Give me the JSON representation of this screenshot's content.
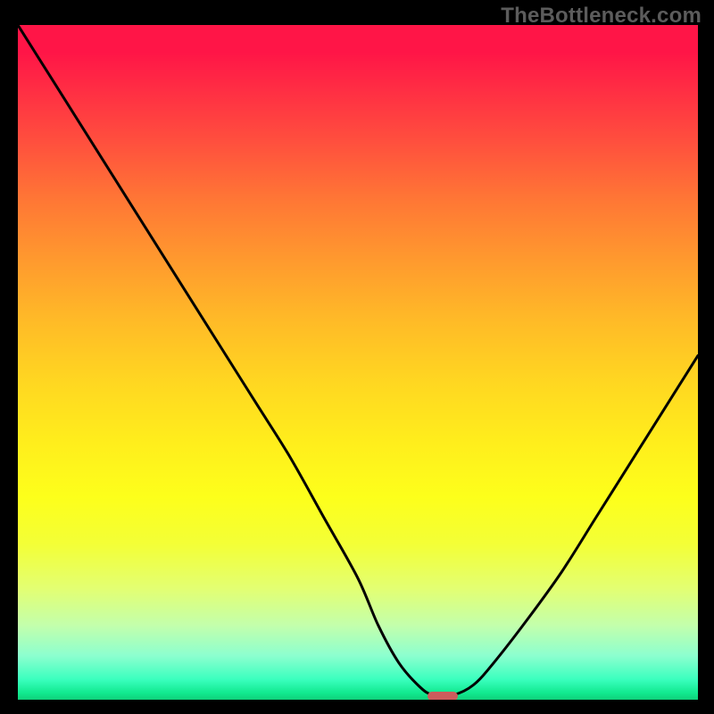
{
  "watermark": "TheBottleneck.com",
  "colors": {
    "frame": "#000000",
    "curve": "#000000",
    "marker": "#cd5c5c"
  },
  "chart_data": {
    "type": "line",
    "title": "",
    "xlabel": "",
    "ylabel": "",
    "xlim": [
      0,
      100
    ],
    "ylim": [
      0,
      100
    ],
    "grid": false,
    "x": [
      0,
      5,
      10,
      15,
      20,
      25,
      30,
      35,
      40,
      45,
      50,
      53,
      56,
      59,
      61,
      64,
      67,
      70,
      75,
      80,
      85,
      90,
      95,
      100
    ],
    "values": [
      100,
      92,
      84,
      76,
      68,
      60,
      52,
      44,
      36,
      27,
      18,
      11,
      5.5,
      2,
      0.7,
      0.7,
      2.2,
      5.5,
      12,
      19,
      27,
      35,
      43,
      51
    ],
    "series": [
      {
        "name": "bottleneck-curve",
        "values": [
          100,
          92,
          84,
          76,
          68,
          60,
          52,
          44,
          36,
          27,
          18,
          11,
          5.5,
          2,
          0.7,
          0.7,
          2.2,
          5.5,
          12,
          19,
          27,
          35,
          43,
          51
        ]
      }
    ],
    "marker": {
      "x": 62.5,
      "y": 0.5
    }
  }
}
